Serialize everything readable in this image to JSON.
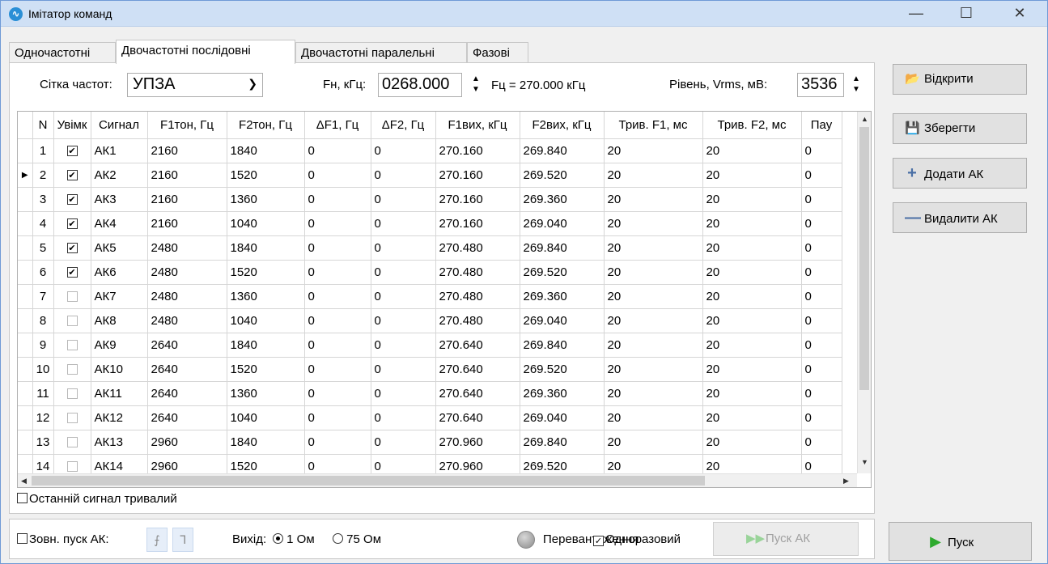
{
  "window": {
    "title": "Імітатор команд",
    "minimize": "—",
    "maximize": "☐",
    "close": "✕"
  },
  "tabs": [
    "Одночастотні",
    "Двочастотні послідовні",
    "Двочастотні паралельні",
    "Фазові"
  ],
  "active_tab": 1,
  "controls": {
    "grid_label": "Сітка частот:",
    "grid_value": "УПЗА",
    "fn_label": "Fн, кГц:",
    "fn_value": "0268.000",
    "fc_text": "Fц = 270.000 кГц",
    "level_label": "Рівень, Vrms, мВ:",
    "level_value": "3536"
  },
  "table": {
    "columns": [
      "",
      "N",
      "Увімк",
      "Сигнал",
      "F1тон, Гц",
      "F2тон, Гц",
      "ΔF1, Гц",
      "ΔF2, Гц",
      "F1вих, кГц",
      "F2вих, кГц",
      "Трив. F1, мс",
      "Трив. F2, мс",
      "Пау"
    ],
    "current_row": 2,
    "rows": [
      {
        "n": "1",
        "on": true,
        "sig": "АК1",
        "f1": "2160",
        "f2": "1840",
        "d1": "0",
        "d2": "0",
        "o1": "270.160",
        "o2": "269.840",
        "t1": "20",
        "t2": "20",
        "p": "0"
      },
      {
        "n": "2",
        "on": true,
        "sig": "АК2",
        "f1": "2160",
        "f2": "1520",
        "d1": "0",
        "d2": "0",
        "o1": "270.160",
        "o2": "269.520",
        "t1": "20",
        "t2": "20",
        "p": "0"
      },
      {
        "n": "3",
        "on": true,
        "sig": "АК3",
        "f1": "2160",
        "f2": "1360",
        "d1": "0",
        "d2": "0",
        "o1": "270.160",
        "o2": "269.360",
        "t1": "20",
        "t2": "20",
        "p": "0"
      },
      {
        "n": "4",
        "on": true,
        "sig": "АК4",
        "f1": "2160",
        "f2": "1040",
        "d1": "0",
        "d2": "0",
        "o1": "270.160",
        "o2": "269.040",
        "t1": "20",
        "t2": "20",
        "p": "0"
      },
      {
        "n": "5",
        "on": true,
        "sig": "АК5",
        "f1": "2480",
        "f2": "1840",
        "d1": "0",
        "d2": "0",
        "o1": "270.480",
        "o2": "269.840",
        "t1": "20",
        "t2": "20",
        "p": "0"
      },
      {
        "n": "6",
        "on": true,
        "sig": "АК6",
        "f1": "2480",
        "f2": "1520",
        "d1": "0",
        "d2": "0",
        "o1": "270.480",
        "o2": "269.520",
        "t1": "20",
        "t2": "20",
        "p": "0"
      },
      {
        "n": "7",
        "on": false,
        "sig": "АК7",
        "f1": "2480",
        "f2": "1360",
        "d1": "0",
        "d2": "0",
        "o1": "270.480",
        "o2": "269.360",
        "t1": "20",
        "t2": "20",
        "p": "0"
      },
      {
        "n": "8",
        "on": false,
        "sig": "АК8",
        "f1": "2480",
        "f2": "1040",
        "d1": "0",
        "d2": "0",
        "o1": "270.480",
        "o2": "269.040",
        "t1": "20",
        "t2": "20",
        "p": "0"
      },
      {
        "n": "9",
        "on": false,
        "sig": "АК9",
        "f1": "2640",
        "f2": "1840",
        "d1": "0",
        "d2": "0",
        "o1": "270.640",
        "o2": "269.840",
        "t1": "20",
        "t2": "20",
        "p": "0"
      },
      {
        "n": "10",
        "on": false,
        "sig": "АК10",
        "f1": "2640",
        "f2": "1520",
        "d1": "0",
        "d2": "0",
        "o1": "270.640",
        "o2": "269.520",
        "t1": "20",
        "t2": "20",
        "p": "0"
      },
      {
        "n": "11",
        "on": false,
        "sig": "АК11",
        "f1": "2640",
        "f2": "1360",
        "d1": "0",
        "d2": "0",
        "o1": "270.640",
        "o2": "269.360",
        "t1": "20",
        "t2": "20",
        "p": "0"
      },
      {
        "n": "12",
        "on": false,
        "sig": "АК12",
        "f1": "2640",
        "f2": "1040",
        "d1": "0",
        "d2": "0",
        "o1": "270.640",
        "o2": "269.040",
        "t1": "20",
        "t2": "20",
        "p": "0"
      },
      {
        "n": "13",
        "on": false,
        "sig": "АК13",
        "f1": "2960",
        "f2": "1840",
        "d1": "0",
        "d2": "0",
        "o1": "270.960",
        "o2": "269.840",
        "t1": "20",
        "t2": "20",
        "p": "0"
      },
      {
        "n": "14",
        "on": false,
        "sig": "АК14",
        "f1": "2960",
        "f2": "1520",
        "d1": "0",
        "d2": "0",
        "o1": "270.960",
        "o2": "269.520",
        "t1": "20",
        "t2": "20",
        "p": "0"
      }
    ]
  },
  "last_signal_long": {
    "label": "Останній сигнал тривалий",
    "checked": false
  },
  "bottom": {
    "ext_start_label": "Зовн. пуск АК:",
    "ext_start_checked": false,
    "edge_rise": "⨍",
    "edge_fall": "ᒣ",
    "output_label": "Вихід:",
    "out_1": "1 Ом",
    "out_75": "75 Ом",
    "out_selected": "1 Ом",
    "overload_label": "Перевантаження",
    "single_label": "Одноразовий",
    "single_checked": true,
    "start_ak_label": "Пуск АК"
  },
  "side_buttons": {
    "open": "Відкрити",
    "save": "Зберегти",
    "add": "Додати АК",
    "delete": "Видалити АК",
    "start": "Пуск"
  },
  "colors": {
    "title_bar": "#cfe0f5",
    "start_icon": "#2eaa2e",
    "accent_icon": "#4a6fa5"
  }
}
